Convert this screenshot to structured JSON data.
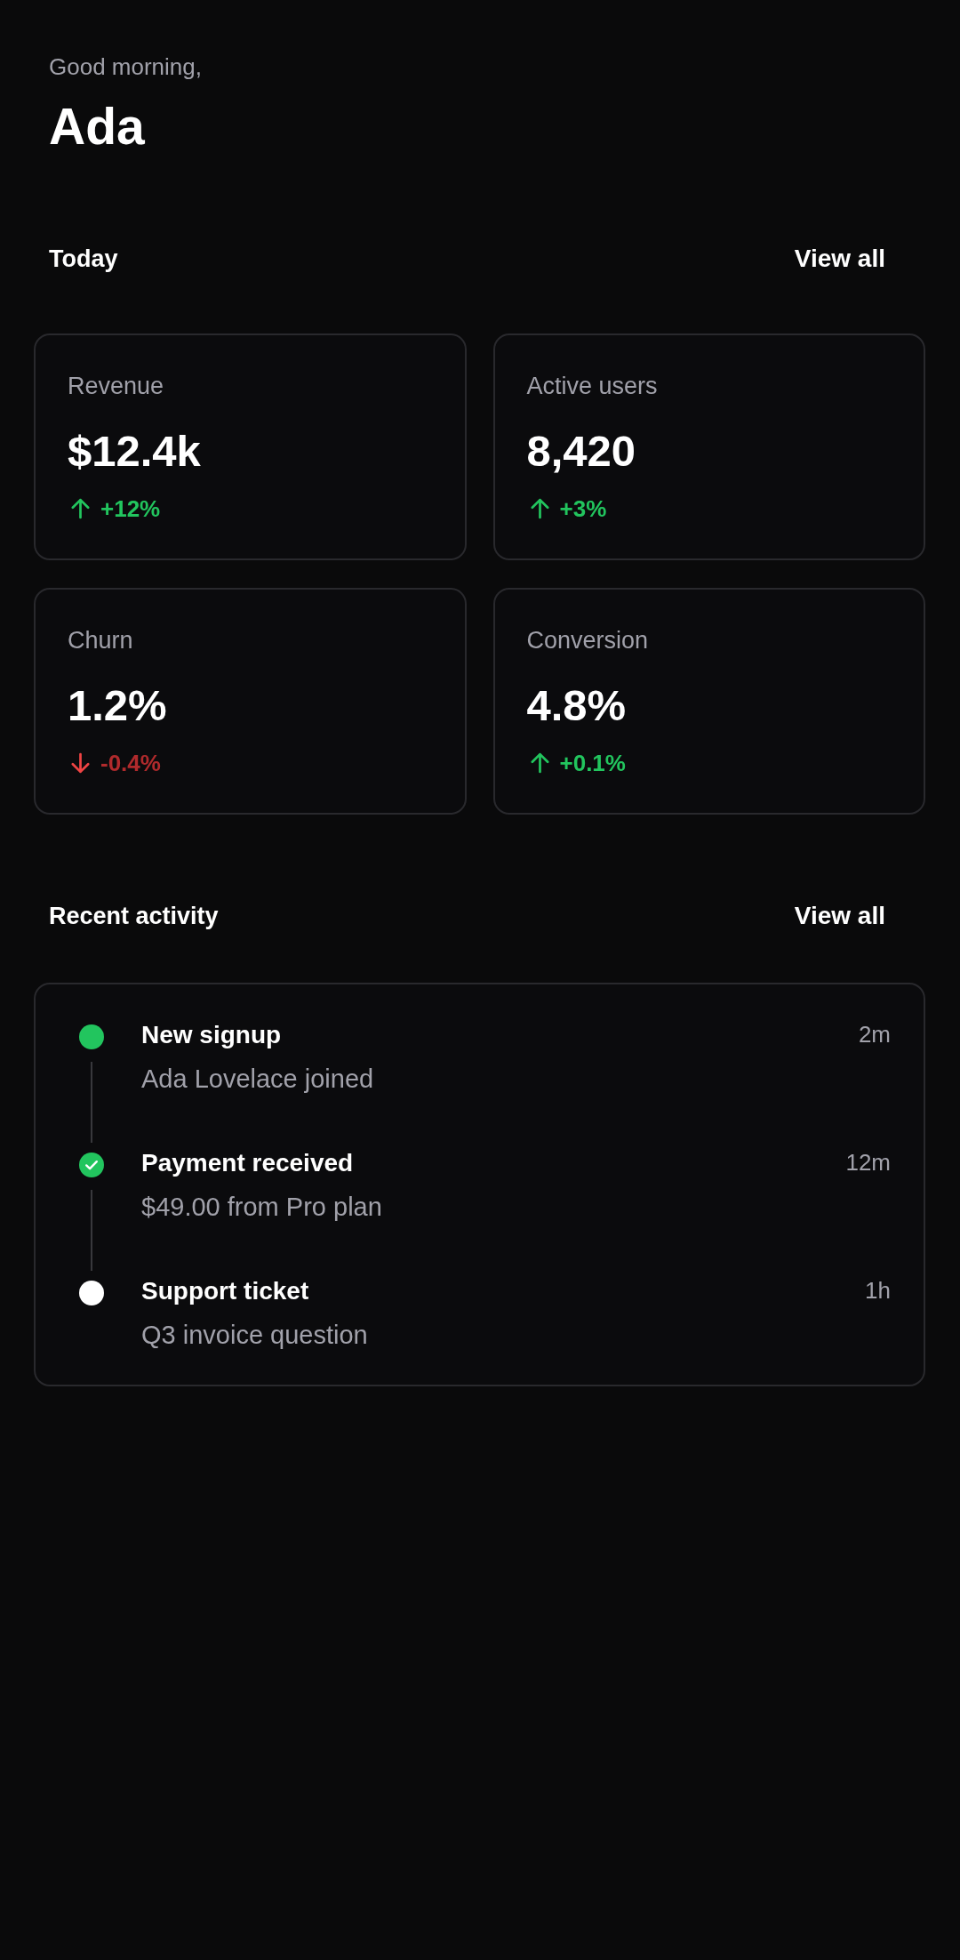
{
  "greeting": {
    "salutation": "Good morning,",
    "name": "Ada"
  },
  "today": {
    "title": "Today",
    "action": "View all",
    "metrics": [
      {
        "label": "Revenue",
        "value": "$12.4k",
        "change": "+12%",
        "kind": "up"
      },
      {
        "label": "Active users",
        "value": "8,420",
        "change": "+3%",
        "kind": "up"
      },
      {
        "label": "Churn",
        "value": "1.2%",
        "change": "-0.4%",
        "kind": "down"
      },
      {
        "label": "Conversion",
        "value": "4.8%",
        "change": "+0.1%",
        "kind": "up"
      }
    ]
  },
  "recent_activity": {
    "title": "Recent activity",
    "action": "View all",
    "items": [
      {
        "title": "New signup",
        "detail": "Ada Lovelace joined",
        "time": "2m",
        "kind": "dot",
        "color": "#22c55e"
      },
      {
        "title": "Payment received",
        "detail": "$49.00 from Pro plan",
        "time": "12m",
        "kind": "check",
        "color": "#22c55e"
      },
      {
        "title": "Support ticket",
        "detail": "Q3 invoice question",
        "time": "1h",
        "kind": "dot",
        "color": "#ffffff"
      }
    ]
  }
}
